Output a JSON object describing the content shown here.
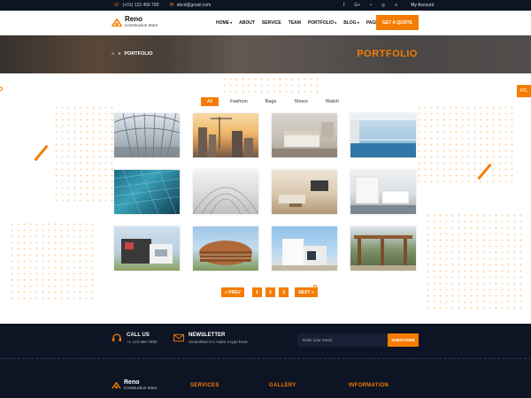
{
  "topbar": {
    "phone": "(+01) 123 456 789",
    "email": "abcd@gmail.com",
    "social": [
      "f",
      "G+",
      "•",
      "◎",
      "≡"
    ],
    "account": "My Account"
  },
  "header": {
    "brand": "Reno",
    "tagline": "Construction Store",
    "nav": [
      {
        "label": "HOME",
        "dropdown": true
      },
      {
        "label": "ABOUT",
        "dropdown": false
      },
      {
        "label": "SERVICE",
        "dropdown": false
      },
      {
        "label": "TEAM",
        "dropdown": false
      },
      {
        "label": "PORTFOLIO",
        "dropdown": true
      },
      {
        "label": "BLOG",
        "dropdown": true
      },
      {
        "label": "PAGE",
        "dropdown": true
      }
    ],
    "cta": "GET A QUOTE"
  },
  "banner": {
    "crumb": "PORTFOLIO",
    "title": "PORTFOLIO"
  },
  "rtl_label": "RTL",
  "filters": [
    {
      "label": "All",
      "active": true
    },
    {
      "label": "Fashion",
      "active": false
    },
    {
      "label": "Bags",
      "active": false
    },
    {
      "label": "Shoes",
      "active": false
    },
    {
      "label": "Watch",
      "active": false
    }
  ],
  "gallery": [
    {
      "name": "glass-walkway-photo"
    },
    {
      "name": "city-cranes-photo"
    },
    {
      "name": "bedroom-interior-photo"
    },
    {
      "name": "modern-balcony-photo"
    },
    {
      "name": "glass-tower-photo"
    },
    {
      "name": "white-arches-photo"
    },
    {
      "name": "living-room-photo"
    },
    {
      "name": "white-kitchen-photo"
    },
    {
      "name": "modern-house-photo"
    },
    {
      "name": "round-building-photo"
    },
    {
      "name": "white-villa-photo"
    },
    {
      "name": "wooden-pergola-photo"
    }
  ],
  "pagination": {
    "prev": "« PREV",
    "pages": [
      "1",
      "2",
      "3"
    ],
    "next": "NEXT »"
  },
  "footer": {
    "call_title": "CALL US",
    "call_number": "+1 123-456-7890",
    "newsletter_title": "NEWSLETTER",
    "newsletter_text": "Scrambled it to make a type book.",
    "email_placeholder": "Enter your email",
    "subscribe": "SUBSCRIBE",
    "brand": "Reno",
    "tagline": "Construction Store",
    "headings": [
      "SERVICES",
      "GALLERY",
      "INFORMATION"
    ]
  },
  "colors": {
    "accent": "#f57c00",
    "dark": "#0d1424"
  }
}
